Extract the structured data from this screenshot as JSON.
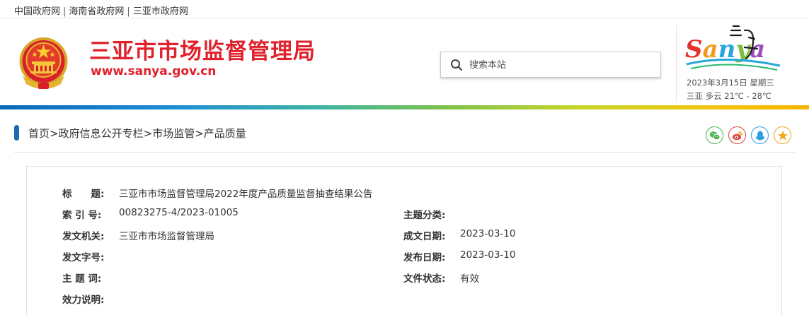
{
  "top_links": [
    "中国政府网",
    "海南省政府网",
    "三亚市政府网"
  ],
  "header": {
    "title": "三亚市市场监督管理局",
    "url": "www.sanya.gov.cn",
    "search_placeholder": "搜索本站",
    "logo_text": "Sanya",
    "date": "2023年3月15日 星期三",
    "weather": "三亚  多云  21℃ - 28℃"
  },
  "breadcrumb": [
    "首页",
    "政府信息公开专栏",
    "市场监管",
    "产品质量"
  ],
  "breadcrumb_separator": ">",
  "share_icons": [
    "wechat-icon",
    "weibo-icon",
    "qq-icon",
    "favorite-icon"
  ],
  "info": {
    "title_label": "标　　题:",
    "title_value": "三亚市市场监督管理局2022年度产品质量监督抽查结果公告",
    "index_label": "索 引 号:",
    "index_value": "00823275-4/2023-01005",
    "topic_class_label": "主题分类:",
    "topic_class_value": "",
    "issuer_label": "发文机关:",
    "issuer_value": "三亚市市场监督管理局",
    "created_label": "成文日期:",
    "created_value": "2023-03-10",
    "doc_no_label": "发文字号:",
    "doc_no_value": "",
    "published_label": "发布日期:",
    "published_value": "2023-03-10",
    "keywords_label": "主 题 词:",
    "keywords_value": "",
    "status_label": "文件状态:",
    "status_value": "有效",
    "validity_label": "效力说明:",
    "validity_value": ""
  },
  "colors": {
    "brand_red": "#e0212b",
    "breadcrumb_blue": "#1d67b3",
    "wechat_green": "#46b44a",
    "weibo_red": "#e2413b",
    "qq_blue": "#2f9ee0",
    "favorite_orange": "#f0a81d"
  }
}
